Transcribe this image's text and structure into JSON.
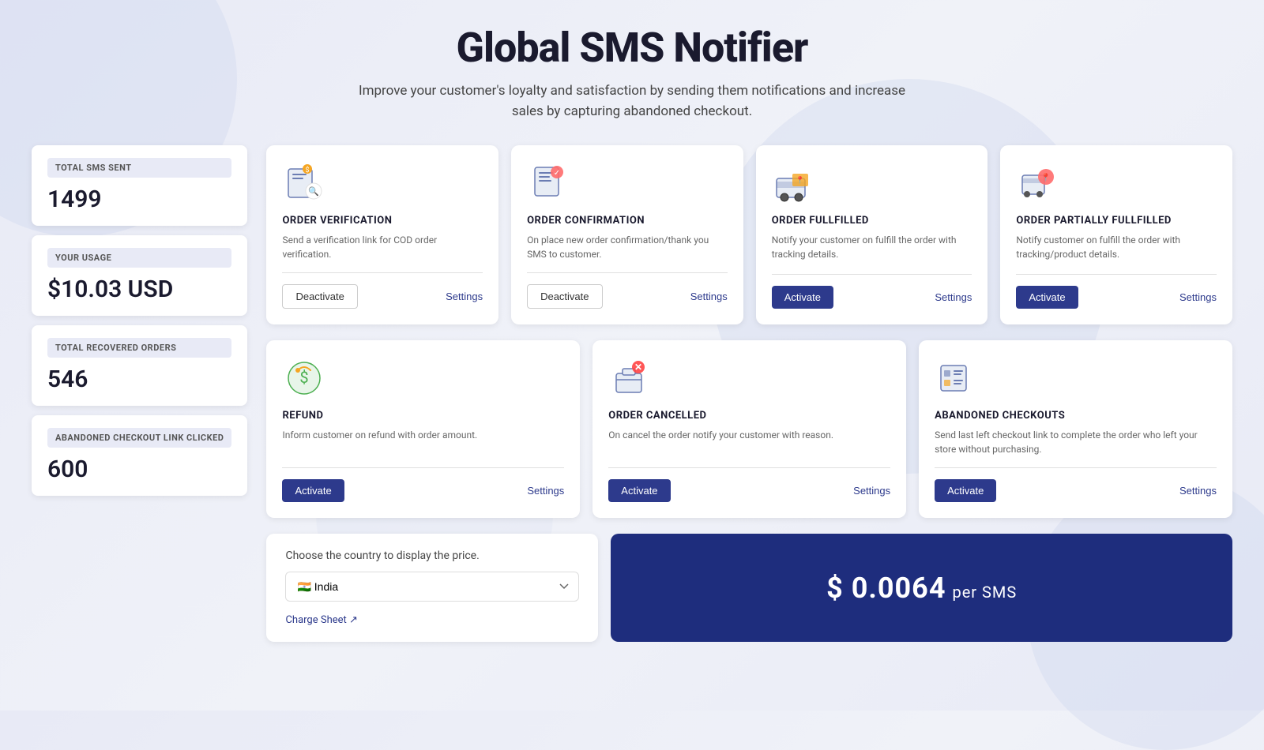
{
  "header": {
    "title": "Global SMS Notifier",
    "subtitle": "Improve your customer's loyalty and satisfaction by sending them notifications and increase sales by capturing abandoned checkout."
  },
  "stats": [
    {
      "id": "total-sms-sent",
      "label": "TOTAL SMS SENT",
      "value": "1499"
    },
    {
      "id": "your-usage",
      "label": "YOUR USAGE",
      "value": "$10.03 USD"
    },
    {
      "id": "total-recovered-orders",
      "label": "TOTAL RECOVERED ORDERS",
      "value": "546"
    },
    {
      "id": "abandoned-checkout-link-clicked",
      "label": "ABANDONED CHECKOUT LINK CLICKED",
      "value": "600"
    }
  ],
  "cards_row1": [
    {
      "id": "order-verification",
      "icon": "📋",
      "title": "ORDER VERIFICATION",
      "description": "Send a verification link for COD order verification.",
      "primary_action": "Deactivate",
      "primary_style": "deactivate",
      "secondary_action": "Settings"
    },
    {
      "id": "order-confirmation",
      "icon": "📝",
      "title": "ORDER CONFIRMATION",
      "description": "On place new order confirmation/thank you SMS to customer.",
      "primary_action": "Deactivate",
      "primary_style": "deactivate",
      "secondary_action": "Settings"
    },
    {
      "id": "order-fulfilled",
      "icon": "🚚",
      "title": "ORDER FULLFILLED",
      "description": "Notify your customer on fulfill the order with tracking details.",
      "primary_action": "Activate",
      "primary_style": "activate",
      "secondary_action": "Settings"
    },
    {
      "id": "order-partially-fulfilled",
      "icon": "📦",
      "title": "ORDER PARTIALLY FULLFILLED",
      "description": "Notify customer on fulfill the order with tracking/product details.",
      "primary_action": "Activate",
      "primary_style": "activate",
      "secondary_action": "Settings"
    }
  ],
  "cards_row2": [
    {
      "id": "refund",
      "icon": "💰",
      "title": "REFUND",
      "description": "Inform customer on refund with order amount.",
      "primary_action": "Activate",
      "primary_style": "activate",
      "secondary_action": "Settings"
    },
    {
      "id": "order-cancelled",
      "icon": "🛒",
      "title": "ORDER CANCELLED",
      "description": "On cancel the order notify your customer with reason.",
      "primary_action": "Activate",
      "primary_style": "activate",
      "secondary_action": "Settings"
    },
    {
      "id": "abandoned-checkouts",
      "icon": "🧾",
      "title": "ABANDONED CHECKOUTS",
      "description": "Send last left checkout link to complete the order who left your store without purchasing.",
      "primary_action": "Activate",
      "primary_style": "activate",
      "secondary_action": "Settings"
    }
  ],
  "pricing": {
    "country_label": "Choose the country to display the price.",
    "country_value": "India",
    "country_flag": "🇮🇳",
    "charge_sheet_label": "Charge Sheet",
    "price_display": "$ 0.0064",
    "price_per": "per SMS"
  }
}
